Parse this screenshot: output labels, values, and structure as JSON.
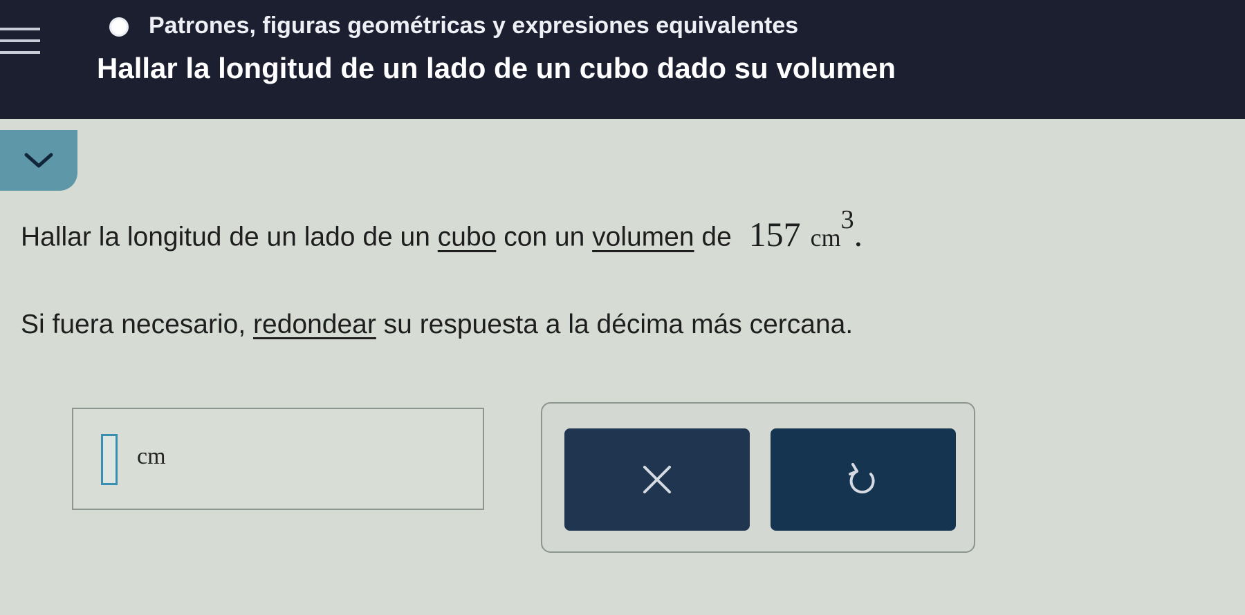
{
  "header": {
    "topic": "Patrones, figuras geométricas y expresiones equivalentes",
    "lesson": "Hallar la longitud de un lado de un cubo dado su volumen"
  },
  "question": {
    "line1_prefix": "Hallar la longitud de un lado de un ",
    "link_cubo": "cubo",
    "line1_middle": " con un ",
    "link_volumen": "volumen",
    "line1_suffix": " de",
    "value": "157",
    "unit": "cm",
    "exponent": "3",
    "period": ".",
    "line2_prefix": "Si fuera necesario, ",
    "link_redondear": "redondear",
    "line2_suffix": " su respuesta a la décima más cercana."
  },
  "answer": {
    "value": "",
    "unit": "cm"
  },
  "buttons": {
    "clear_icon": "close-icon",
    "undo_icon": "undo-icon"
  },
  "colors": {
    "header_bg": "#1c1f30",
    "accent": "#5e98a8",
    "button_bg": "#1f3550"
  }
}
